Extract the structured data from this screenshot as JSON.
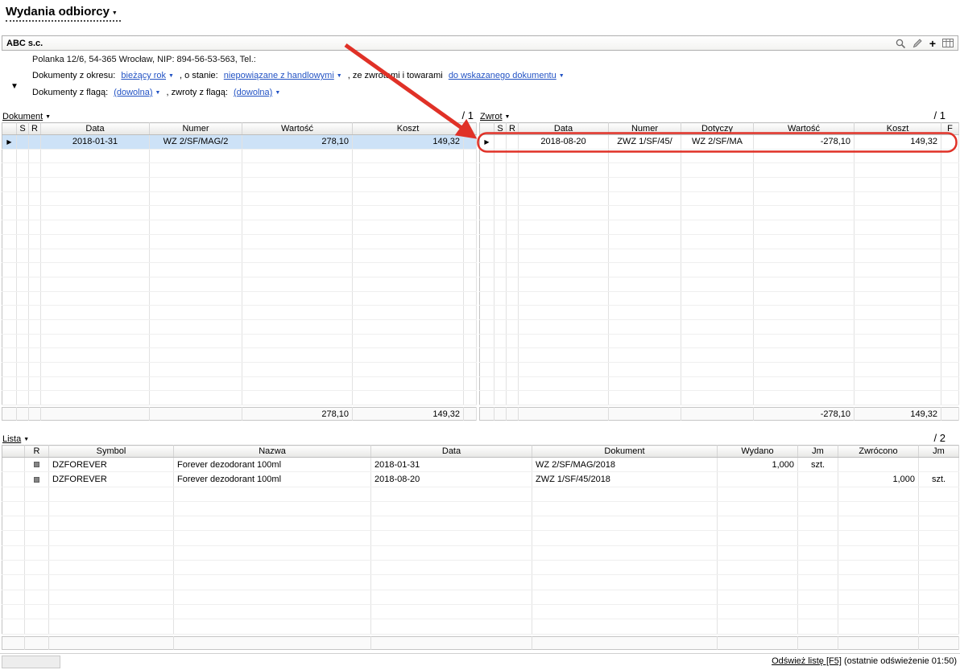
{
  "colors": {
    "link_blue": "#2353c4",
    "selection_blue": "#cde2f7",
    "annotation_red": "#e03127",
    "header_gray": "#e7e7e5"
  },
  "page": {
    "title": "Wydania odbiorcy",
    "refresh_link": "Odśwież listę [F5]",
    "refresh_suffix": " (ostatnie odświeżenie 01:50)"
  },
  "company": {
    "name": "ABC s.c.",
    "address": "Polanka 12/6, 54-365 Wrocław, NIP: 894-56-53-563, Tel.:"
  },
  "filters": {
    "period_label": "Dokumenty z okresu:",
    "period_value": "bieżący rok",
    "state_label": ", o stanie:",
    "state_value": "niepowiązane z handlowymi",
    "returns_label": ", ze zwrotami i towarami",
    "target_value": "do wskazanego dokumentu",
    "flag_label": "Dokumenty z flagą:",
    "flag_value": "(dowolna)",
    "return_flag_label": ", zwroty z flagą:",
    "return_flag_value": "(dowolna)"
  },
  "icons": {
    "bar": [
      "search-icon",
      "edit-pencil-icon",
      "add-plus-icon",
      "table-columns-icon"
    ],
    "row_pointer": "right-triangle",
    "row_marker": "gray-square"
  },
  "documents_table": {
    "menu_label": "Dokument",
    "counter": "/ 1",
    "headers": [
      "",
      "S",
      "R",
      "Data",
      "Numer",
      "Wartość",
      "Koszt",
      ""
    ],
    "rows": [
      {
        "current": true,
        "selected": true,
        "cells": {
          "data": "2018-01-31",
          "numer": "WZ 2/SF/MAG/2",
          "wartosc": "278,10",
          "koszt": "149,32"
        }
      }
    ],
    "footer": {
      "wartosc": "278,10",
      "koszt": "149,32"
    }
  },
  "returns_table": {
    "menu_label": "Zwrot",
    "counter": "/ 1",
    "headers": [
      "",
      "S",
      "R",
      "Data",
      "Numer",
      "Dotyczy",
      "Wartość",
      "Koszt",
      "F"
    ],
    "rows": [
      {
        "current": true,
        "selected": false,
        "cells": {
          "data": "2018-08-20",
          "numer": "ZWZ 1/SF/45/",
          "dotyczy": "WZ 2/SF/MA",
          "wartosc": "-278,10",
          "koszt": "149,32"
        }
      }
    ],
    "footer": {
      "wartosc": "-278,10",
      "koszt": "149,32"
    }
  },
  "items_table": {
    "menu_label": "Lista",
    "counter": "/ 2",
    "headers": [
      "",
      "R",
      "Symbol",
      "Nazwa",
      "Data",
      "Dokument",
      "Wydano",
      "Jm",
      "Zwrócono",
      "Jm"
    ],
    "rows": [
      {
        "marker": true,
        "cells": {
          "symbol": "DZFOREVER",
          "nazwa": "Forever dezodorant 100ml",
          "data": "2018-01-31",
          "dokument": "WZ 2/SF/MAG/2018",
          "wydano": "1,000",
          "jm1": "szt."
        }
      },
      {
        "marker": true,
        "cells": {
          "symbol": "DZFOREVER",
          "nazwa": "Forever dezodorant 100ml",
          "data": "2018-08-20",
          "dokument": "ZWZ 1/SF/45/2018",
          "zwrocono": "1,000",
          "jm2": "szt."
        }
      }
    ],
    "footer": {}
  }
}
